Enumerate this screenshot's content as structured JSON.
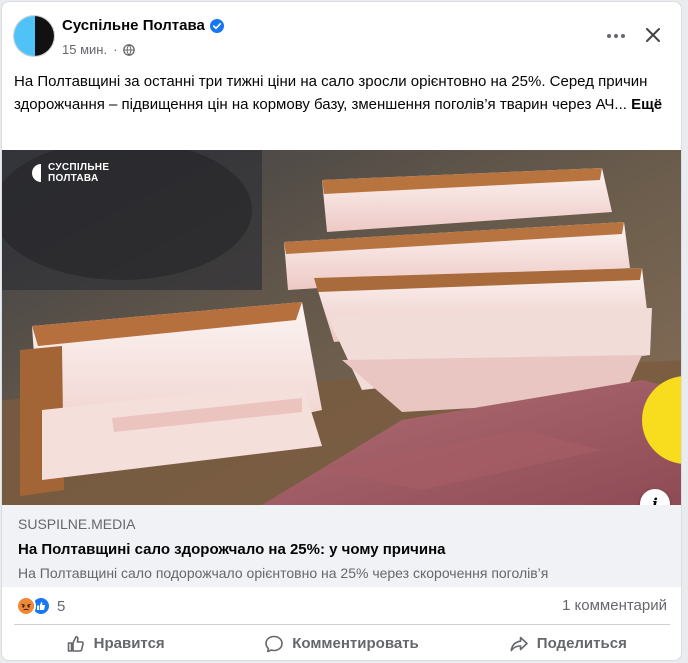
{
  "post": {
    "page_name": "Суспільне Полтава",
    "time": "15 мин.",
    "visibility_icon": "globe-icon",
    "verified_icon": "verified-badge-icon",
    "text": "На Полтавщині за останні три тижні ціни на сало зросли орієнтовно на 25%. Серед причин здорожчання – підвищення цін на кормову базу, зменшення поголів’я тварин через АЧ...",
    "see_more": "Ещё"
  },
  "image": {
    "watermark_line1": "СУСПІЛЬНЕ",
    "watermark_line2": "ПОЛТАВА"
  },
  "link_preview": {
    "domain": "SUSPILNE.MEDIA",
    "title": "На Полтавщині сало здорожчало на 25%: у чому причина",
    "description": "На Полтавщині сало подорожчало орієнтовно на 25% через скорочення поголів’я"
  },
  "stats": {
    "reaction_count": "5",
    "comments": "1 комментарий"
  },
  "actions": {
    "like": "Нравится",
    "comment": "Комментировать",
    "share": "Поделиться"
  },
  "colors": {
    "brand_blue": "#1877f2",
    "angry_orange": "#f0883a",
    "muted_text": "#65676b",
    "preview_bg": "#f0f2f5",
    "yellow_accent": "#f7dd1e"
  }
}
